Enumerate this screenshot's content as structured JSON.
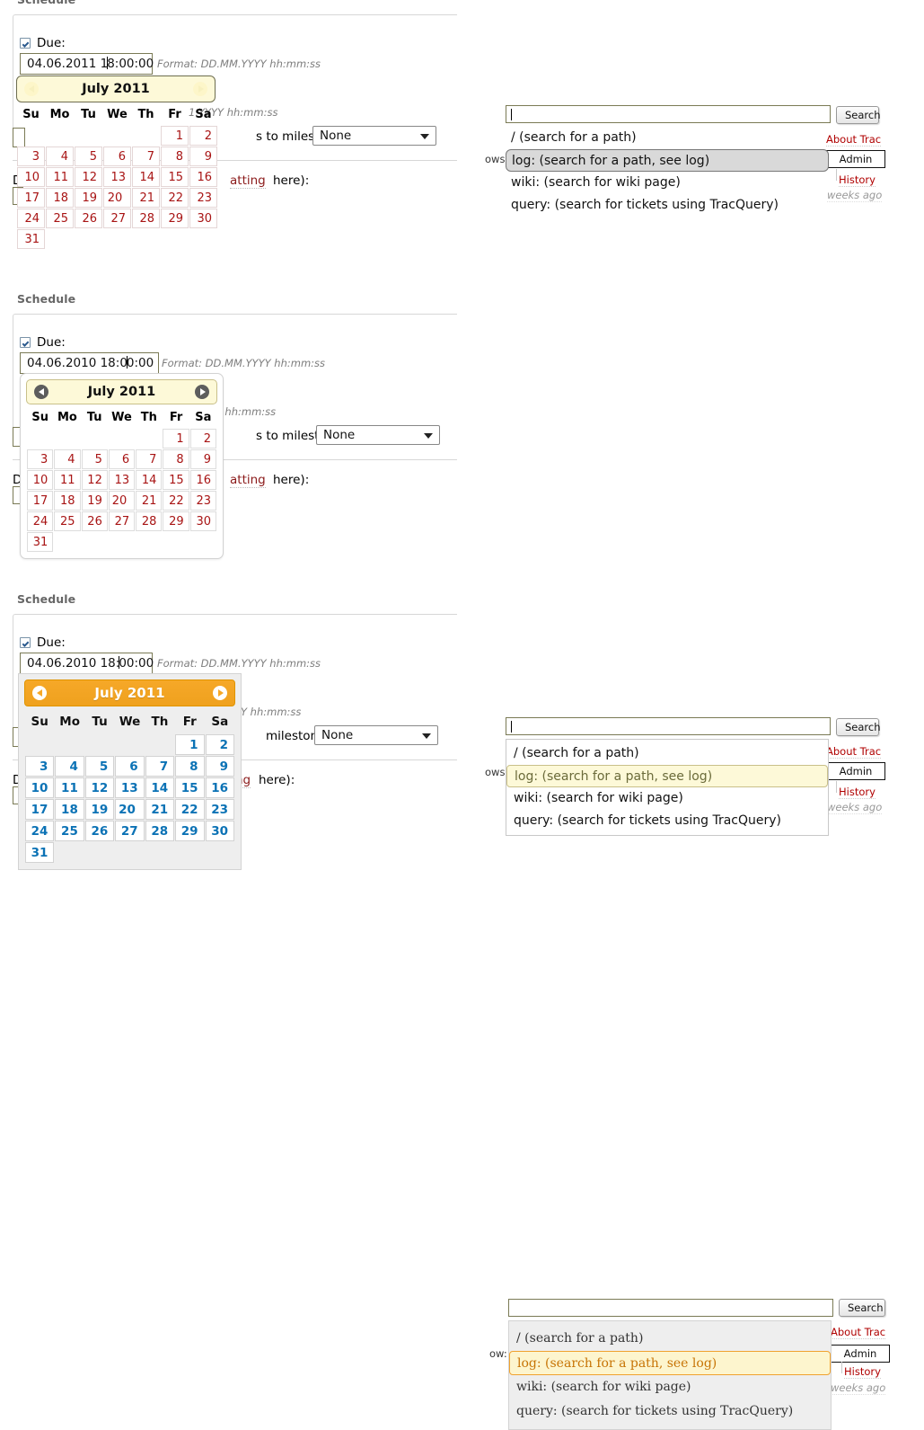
{
  "sections": [
    {
      "id": "flat",
      "legend": "Schedule",
      "due_label": "Due:",
      "date_value_pre": "04.06.2011 1",
      "date_value_post": "8:00:00",
      "format_hint": "Format: DD.MM.YYYY hh:mm:ss",
      "format_hint_clipped": "1.YYYY hh:mm:ss",
      "milestone_label": "s to milestone:",
      "milestone_value": "None",
      "description_fragment": "D",
      "description_wiki": "atting",
      "description_tail": " here):",
      "calendar": {
        "title": "July 2011",
        "prev_icon": "chevron-left",
        "next_icon": "chevron-right",
        "weekdays": [
          "Su",
          "Mo",
          "Tu",
          "We",
          "Th",
          "Fr",
          "Sa"
        ],
        "weeks": [
          [
            "",
            "",
            "",
            "",
            "",
            "1",
            "2"
          ],
          [
            "3",
            "4",
            "5",
            "6",
            "7",
            "8",
            "9"
          ],
          [
            "10",
            "11",
            "12",
            "13",
            "14",
            "15",
            "16"
          ],
          [
            "17",
            "18",
            "19",
            "20",
            "21",
            "22",
            "23"
          ],
          [
            "24",
            "25",
            "26",
            "27",
            "28",
            "29",
            "30"
          ],
          [
            "31",
            "",
            "",
            "",
            "",
            "",
            ""
          ]
        ],
        "today": "9",
        "selected": "20"
      },
      "search": {
        "value": "",
        "button_label": "Search",
        "options": [
          "/ (search for a path)",
          "log: (search for a path, see log)",
          "wiki: (search for wiki page)",
          "query: (search for tickets using TracQuery)"
        ],
        "active_index": 1,
        "clipped_left_text": "ows"
      },
      "sidebar": {
        "about": "About Trac",
        "admin": "Admin",
        "history": "History",
        "age": "weeks ago"
      }
    },
    {
      "id": "panel",
      "legend": "Schedule",
      "due_label": "Due:",
      "date_value_pre": "04.06.2010 18:0",
      "date_value_post": "0:00",
      "format_hint": "Format: DD.MM.YYYY hh:mm:ss",
      "format_hint_clipped": ".YYYY hh:mm:ss",
      "milestone_label": "s to milestone:",
      "milestone_value": "None",
      "description_fragment": "D",
      "description_wiki": "atting",
      "description_tail": " here):",
      "calendar": {
        "title": "July 2011",
        "prev_icon": "chevron-left",
        "next_icon": "chevron-right",
        "weekdays": [
          "Su",
          "Mo",
          "Tu",
          "We",
          "Th",
          "Fr",
          "Sa"
        ],
        "weeks": [
          [
            "",
            "",
            "",
            "",
            "",
            "1",
            "2"
          ],
          [
            "3",
            "4",
            "5",
            "6",
            "7",
            "8",
            "9"
          ],
          [
            "10",
            "11",
            "12",
            "13",
            "14",
            "15",
            "16"
          ],
          [
            "17",
            "18",
            "19",
            "20",
            "21",
            "22",
            "23"
          ],
          [
            "24",
            "25",
            "26",
            "27",
            "28",
            "29",
            "30"
          ],
          [
            "31",
            "",
            "",
            "",
            "",
            "",
            ""
          ]
        ],
        "today": "9",
        "selected": "20"
      },
      "search": {
        "value": "",
        "button_label": "Search",
        "options": [
          "/ (search for a path)",
          "log: (search for a path, see log)",
          "wiki: (search for wiki page)",
          "query: (search for tickets using TracQuery)"
        ],
        "active_index": 1,
        "clipped_left_text": "ows"
      },
      "sidebar": {
        "about": "About Trac",
        "admin": "Admin",
        "history": "History",
        "age": "weeks ago"
      }
    },
    {
      "id": "orange",
      "legend": "Schedule",
      "due_label": "Due:",
      "date_value_pre": "04.06.2010 18:",
      "date_value_post": "00:00",
      "format_hint": "Format: DD.MM.YYYY hh:mm:ss",
      "format_hint_clipped": "Y hh:mm:ss",
      "milestone_label": "milestone:",
      "milestone_value": "None",
      "description_fragment": "D",
      "description_wiki": "ng",
      "description_tail": " here):",
      "calendar": {
        "title": "July 2011",
        "prev_icon": "chevron-left",
        "next_icon": "chevron-right",
        "weekdays": [
          "Su",
          "Mo",
          "Tu",
          "We",
          "Th",
          "Fr",
          "Sa"
        ],
        "weeks": [
          [
            "",
            "",
            "",
            "",
            "",
            "1",
            "2"
          ],
          [
            "3",
            "4",
            "5",
            "6",
            "7",
            "8",
            "9"
          ],
          [
            "10",
            "11",
            "12",
            "13",
            "14",
            "15",
            "16"
          ],
          [
            "17",
            "18",
            "19",
            "20",
            "21",
            "22",
            "23"
          ],
          [
            "24",
            "25",
            "26",
            "27",
            "28",
            "29",
            "30"
          ],
          [
            "31",
            "",
            "",
            "",
            "",
            "",
            ""
          ]
        ],
        "today": "9",
        "selected": "20"
      },
      "search": {
        "value": "",
        "button_label": "Search",
        "options": [
          "/ (search for a path)",
          "log: (search for a path, see log)",
          "wiki: (search for wiki page)",
          "query: (search for tickets using TracQuery)"
        ],
        "active_index": 1,
        "clipped_left_text": "ow:"
      },
      "sidebar": {
        "about": "About Trac",
        "admin": "Admin",
        "history": "History",
        "age": "weeks ago"
      }
    }
  ],
  "colors": {
    "cream_header": "#fdf9d8",
    "orange_header": "#f6a828",
    "today_green": "#d8f3d8",
    "today_yellow": "#fdf5ce",
    "day_red": "#a81414",
    "day_blue": "#0b72b5",
    "trac_red": "#b00000"
  }
}
